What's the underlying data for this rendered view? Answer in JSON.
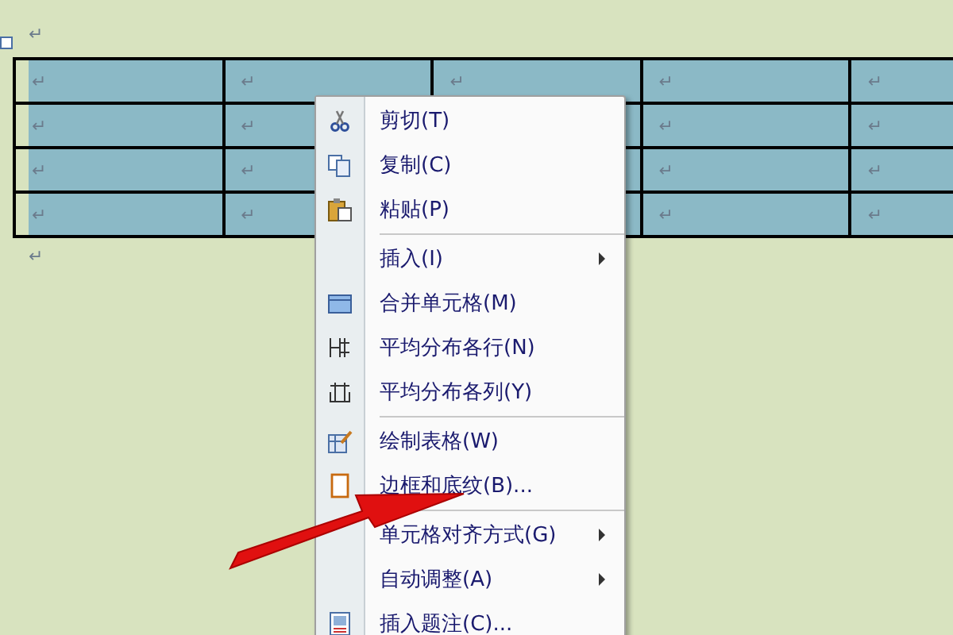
{
  "document": {
    "mark_before": "↵",
    "mark_after": "↵"
  },
  "table": {
    "rows": [
      {
        "cells": [
          {
            "mark": "↵"
          },
          {
            "mark": "↵"
          },
          {
            "mark": "↵"
          },
          {
            "mark": "↵"
          },
          {
            "mark": "↵"
          }
        ]
      },
      {
        "cells": [
          {
            "mark": "↵"
          },
          {
            "mark": "↵"
          },
          {},
          {
            "mark": "↵"
          },
          {
            "mark": "↵"
          }
        ]
      },
      {
        "cells": [
          {
            "mark": "↵"
          },
          {
            "mark": "↵"
          },
          {},
          {
            "mark": "↵"
          },
          {
            "mark": "↵"
          }
        ]
      },
      {
        "cells": [
          {
            "mark": "↵"
          },
          {
            "mark": "↵"
          },
          {},
          {
            "mark": "↵"
          },
          {
            "mark": "↵"
          }
        ]
      }
    ]
  },
  "context_menu": {
    "items": [
      {
        "kind": "item",
        "label": "剪切(T)",
        "submenu": false
      },
      {
        "kind": "item",
        "label": "复制(C)",
        "submenu": false
      },
      {
        "kind": "item",
        "label": "粘贴(P)",
        "submenu": false
      },
      {
        "kind": "separator"
      },
      {
        "kind": "item",
        "label": "插入(I)",
        "submenu": true
      },
      {
        "kind": "item",
        "label": "合并单元格(M)",
        "submenu": false
      },
      {
        "kind": "item",
        "label": "平均分布各行(N)",
        "submenu": false
      },
      {
        "kind": "item",
        "label": "平均分布各列(Y)",
        "submenu": false
      },
      {
        "kind": "separator"
      },
      {
        "kind": "item",
        "label": "绘制表格(W)",
        "submenu": false
      },
      {
        "kind": "item",
        "label": "边框和底纹(B)...",
        "submenu": false
      },
      {
        "kind": "separator"
      },
      {
        "kind": "item",
        "label": "单元格对齐方式(G)",
        "submenu": true
      },
      {
        "kind": "item",
        "label": "自动调整(A)",
        "submenu": true
      },
      {
        "kind": "item",
        "label": "插入题注(C)...",
        "submenu": false
      }
    ]
  }
}
